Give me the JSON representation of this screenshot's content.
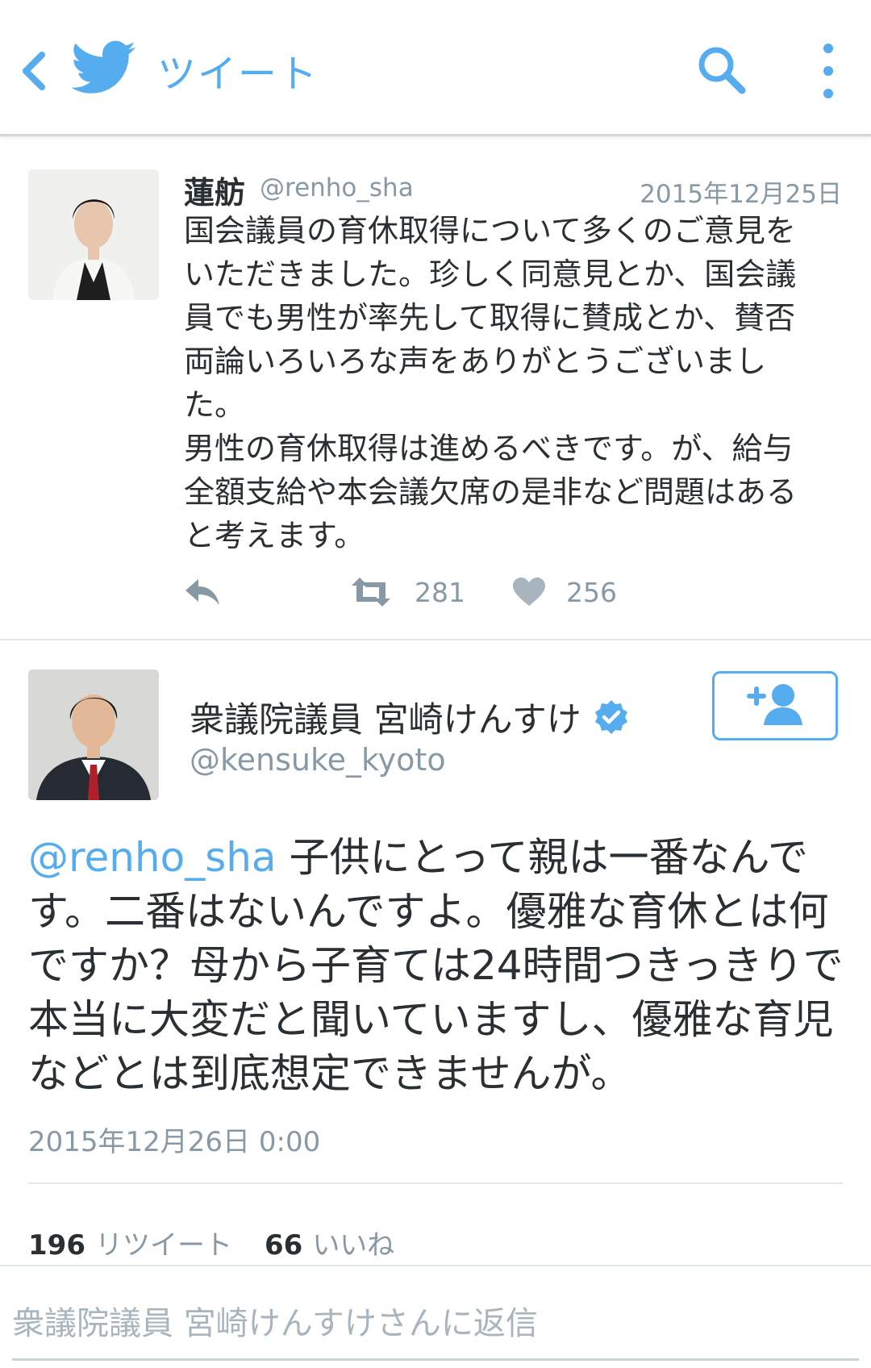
{
  "header": {
    "title": "ツイート"
  },
  "tweet1": {
    "name": "蓮舫",
    "handle": "@renho_sha",
    "date": "2015年12月25日",
    "text": "国会議員の育休取得について多くのご意見を\nいただきました。珍しく同意見とか、国会議\n員でも男性が率先して取得に賛成とか、賛否\n両論いろいろな声をありがとうございまし\nた。\n男性の育休取得は進めるべきです。が、給与\n全額支給や本会議欠席の是非など問題はある\nと考えます。",
    "retweets": "281",
    "likes": "256"
  },
  "tweet2": {
    "name": "衆議院議員 宮崎けんすけ",
    "handle": "@kensuke_kyoto",
    "mention": "@renho_sha",
    "text": " 子供にとって親は一番なんです。二番はないんですよ。優雅な育休とは何ですか？母から子育ては24時間つきっきりで本当に大変だと聞いていますし、優雅な育児などとは到底想定できませんが。",
    "date": "2015年12月26日 0:00",
    "retweet_count": "196",
    "retweet_label": "リツイート",
    "like_count": "66",
    "like_label": "いいね"
  },
  "reply": {
    "placeholder": "衆議院議員 宮崎けんすけさんに返信"
  },
  "colors": {
    "accent": "#55acee",
    "text": "#292f33",
    "muted": "#8899a6"
  },
  "icons": [
    "back-icon",
    "twitter-bird-icon",
    "search-icon",
    "more-vertical-icon",
    "reply-icon",
    "retweet-icon",
    "heart-icon",
    "verified-icon",
    "follow-user-icon"
  ]
}
